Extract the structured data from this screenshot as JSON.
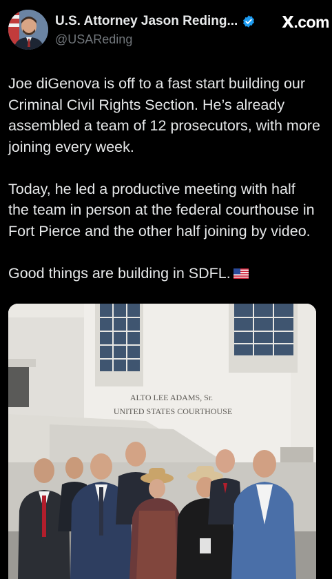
{
  "author": {
    "display_name": "U.S. Attorney Jason Reding...",
    "handle": "@USAReding",
    "verified": true,
    "avatar": "avatar-portrait"
  },
  "brand": {
    "prefix": "X",
    "suffix": ".com"
  },
  "tweet": {
    "paragraphs": [
      "Joe diGenova is off to a fast start building our\nCriminal Civil Rights Section. He’s already\nassembled a team of 12 prosecutors, with more\njoining every week.",
      "Today, he led a productive meeting with half\nthe team in person at the federal courthouse in\nFort Pierce and the other half joining by video.",
      "Good things are building in SDFL."
    ],
    "flag_icon": "us-flag-emoji"
  },
  "photo": {
    "building_sign_line1": "ALTO LEE ADAMS, Sr.",
    "building_sign_line2": "UNITED STATES COURTHOUSE"
  },
  "colors": {
    "background": "#000000",
    "text": "#e7e9ea",
    "muted": "#71767b",
    "verified": "#1d9bf0"
  }
}
